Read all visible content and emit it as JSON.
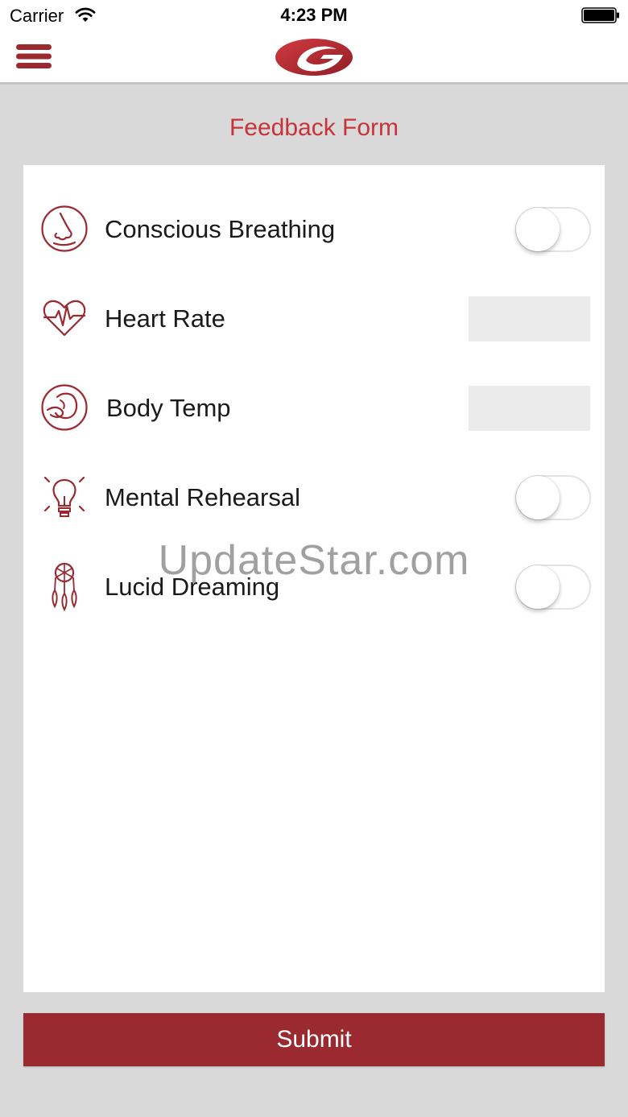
{
  "status_bar": {
    "carrier": "Carrier",
    "time": "4:23 PM"
  },
  "nav": {
    "menu_icon": "hamburger-menu-icon",
    "logo_icon": "brand-logo-icon"
  },
  "form": {
    "title": "Feedback Form",
    "items": [
      {
        "label": "Conscious Breathing",
        "icon": "nose-breathing-icon",
        "control": "toggle",
        "checked": false
      },
      {
        "label": "Heart Rate",
        "icon": "heart-rate-icon",
        "control": "input",
        "value": ""
      },
      {
        "label": "Body Temp",
        "icon": "body-temp-icon",
        "control": "input",
        "value": ""
      },
      {
        "label": "Mental Rehearsal",
        "icon": "lightbulb-icon",
        "control": "toggle",
        "checked": false
      },
      {
        "label": "Lucid Dreaming",
        "icon": "dreamcatcher-icon",
        "control": "toggle",
        "checked": false
      }
    ]
  },
  "submit_label": "Submit",
  "watermark": "UpdateStar.com",
  "colors": {
    "accent": "#9a2a30",
    "title_red": "#c8323a",
    "background": "#d9d9d9",
    "input_bg": "#ebebeb"
  }
}
